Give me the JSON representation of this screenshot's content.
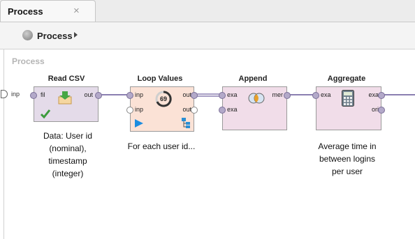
{
  "tab": {
    "label": "Process",
    "close": "×"
  },
  "breadcrumb": {
    "label": "Process"
  },
  "canvas": {
    "title": "Process",
    "input_port": "inp",
    "operators": {
      "read_csv": {
        "title": "Read CSV",
        "ports": {
          "fil": "fil",
          "out": "out"
        },
        "note": [
          "Data: User id",
          "(nominal),",
          "timestamp",
          "(integer)"
        ]
      },
      "loop_values": {
        "title": "Loop Values",
        "badge": "69",
        "ports": {
          "inp1": "inp",
          "inp2": "inp",
          "out1": "out",
          "out2": "out"
        },
        "note": [
          "For each user id..."
        ]
      },
      "append": {
        "title": "Append",
        "ports": {
          "exa1": "exa",
          "exa2": "exa",
          "mer": "mer"
        }
      },
      "aggregate": {
        "title": "Aggregate",
        "ports": {
          "exa_in": "exa",
          "exa_out": "exa",
          "ori": "ori"
        },
        "note": [
          "Average time in",
          "between logins",
          "per user"
        ]
      }
    }
  }
}
